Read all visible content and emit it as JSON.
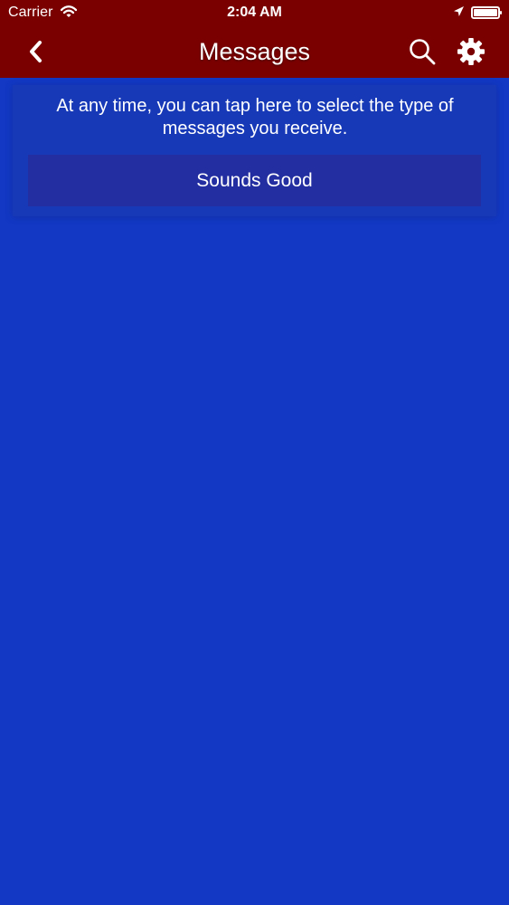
{
  "status_bar": {
    "carrier": "Carrier",
    "time": "2:04 AM",
    "wifi_icon": "wifi-icon",
    "location_icon": "location-arrow-icon",
    "battery_icon": "battery-icon"
  },
  "header": {
    "title": "Messages",
    "back_icon": "chevron-left-icon",
    "search_icon": "search-icon",
    "settings_icon": "gear-icon"
  },
  "hint": {
    "message": "At any time, you can tap here to select the type of messages you receive.",
    "button_label": "Sounds Good"
  },
  "colors": {
    "header_background": "#7A0000",
    "screen_background": "#1238C4",
    "hint_card_background": "#1739B7",
    "button_background": "#232EA0",
    "text": "#FFFFFF"
  }
}
